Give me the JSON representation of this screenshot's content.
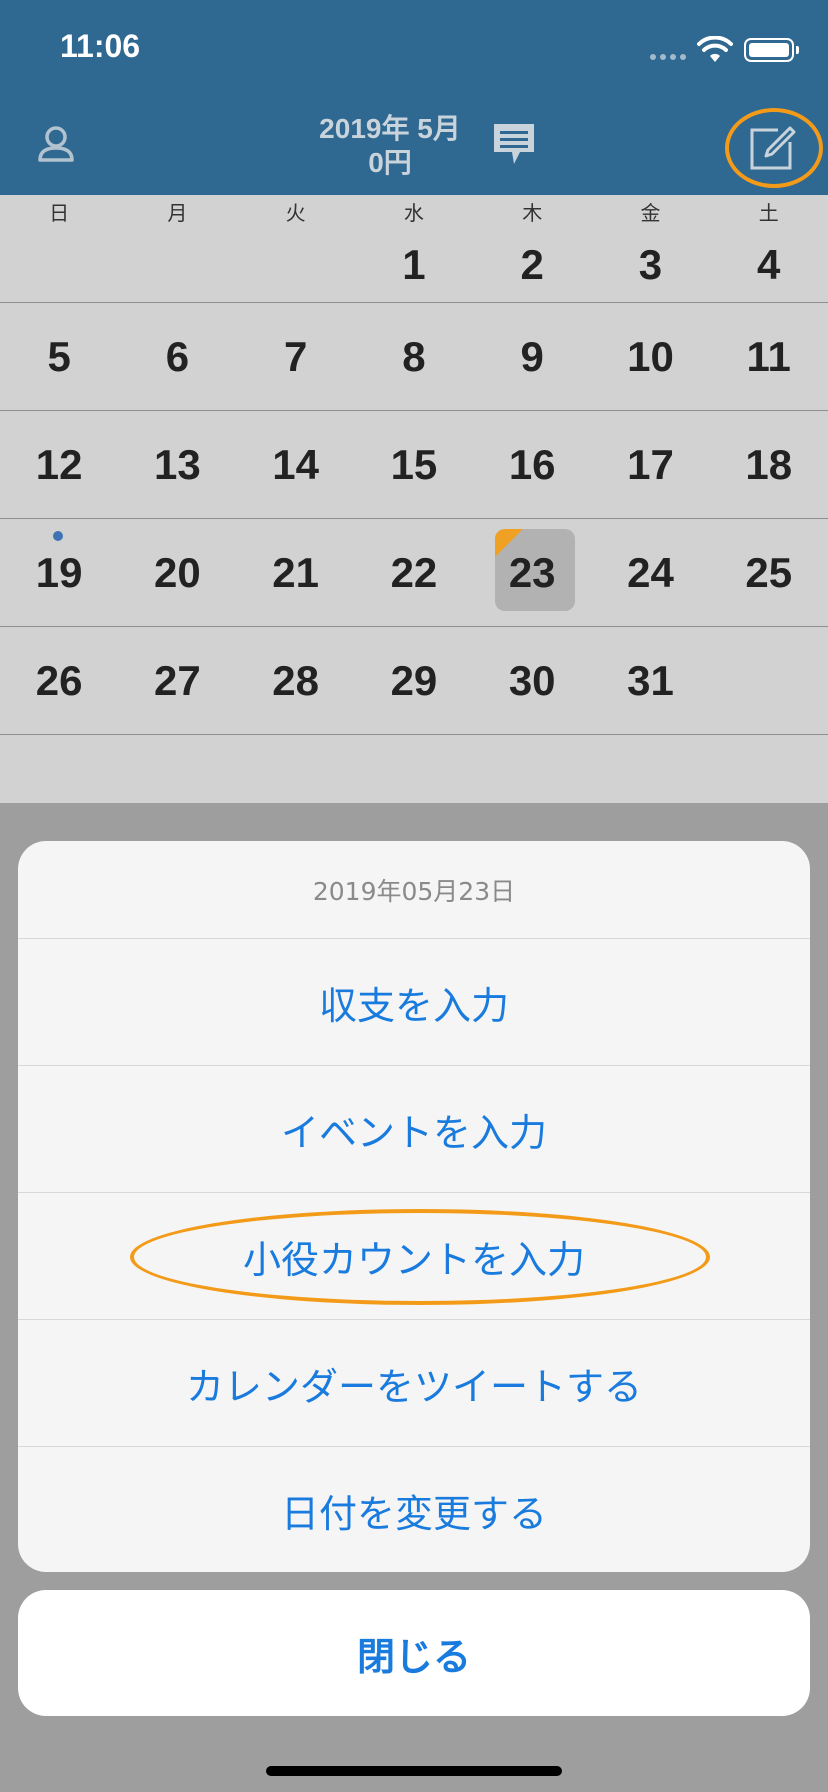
{
  "status_bar": {
    "time": "11:06"
  },
  "nav": {
    "year_month": "2019年 5月",
    "amount": "0円"
  },
  "calendar": {
    "weekdays": [
      "日",
      "月",
      "火",
      "水",
      "木",
      "金",
      "土"
    ],
    "weeks": [
      [
        "",
        "",
        "",
        "1",
        "2",
        "3",
        "4"
      ],
      [
        "5",
        "6",
        "7",
        "8",
        "9",
        "10",
        "11"
      ],
      [
        "12",
        "13",
        "14",
        "15",
        "16",
        "17",
        "18"
      ],
      [
        "19",
        "20",
        "21",
        "22",
        "23",
        "24",
        "25"
      ],
      [
        "26",
        "27",
        "28",
        "29",
        "30",
        "31",
        ""
      ]
    ],
    "today": "23",
    "event_day": "19"
  },
  "action_sheet": {
    "title": "2019年05月23日",
    "items": [
      "収支を入力",
      "イベントを入力",
      "小役カウントを入力",
      "カレンダーをツイートする",
      "日付を変更する"
    ],
    "close_label": "閉じる"
  },
  "colors": {
    "nav": "#2f6890",
    "accent": "#1a7bde",
    "highlight": "#f39b19",
    "today_marker": "#f0a023"
  }
}
